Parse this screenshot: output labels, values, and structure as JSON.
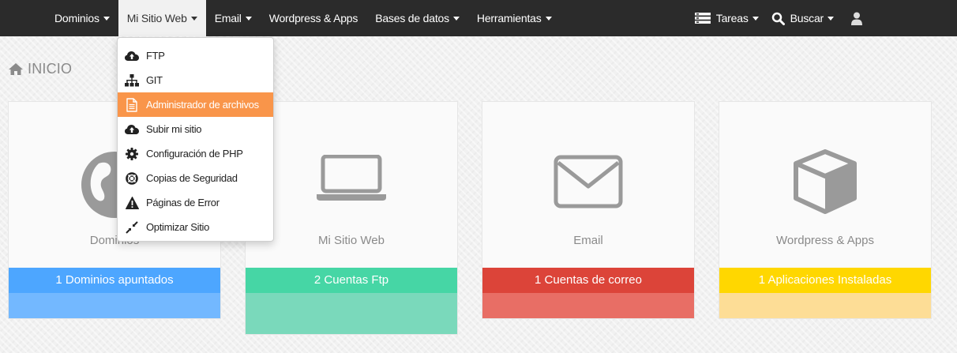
{
  "colors": {
    "navbar_bg": "#2b2b2b",
    "highlight": "#f9954a",
    "card_domains_stat": "#4da6ff",
    "card_domains_footer": "#73b8ff",
    "card_site_stat": "#46d6a5",
    "card_site_footer": "#7ad9bb",
    "card_email_stat": "#dc4439",
    "card_email_footer": "#e86e65",
    "card_apps_stat": "#ffd700",
    "card_apps_footer": "#fddd96"
  },
  "navbar": {
    "items": [
      {
        "label": "Dominios"
      },
      {
        "label": "Mi Sitio Web"
      },
      {
        "label": "Email"
      },
      {
        "label": "Wordpress & Apps"
      },
      {
        "label": "Bases de datos"
      },
      {
        "label": "Herramientas"
      }
    ],
    "tasks_label": "Tareas",
    "search_label": "Buscar"
  },
  "page": {
    "title": "INICIO"
  },
  "dropdown": {
    "items": [
      {
        "label": "FTP",
        "icon": "cloud-upload-icon"
      },
      {
        "label": "GIT",
        "icon": "sitemap-icon"
      },
      {
        "label": "Administrador de archivos",
        "icon": "file-icon"
      },
      {
        "label": "Subir mi sitio",
        "icon": "cloud-upload-icon"
      },
      {
        "label": "Configuración de PHP",
        "icon": "gear-icon"
      },
      {
        "label": "Copias de Seguridad",
        "icon": "life-ring-icon"
      },
      {
        "label": "Páginas de Error",
        "icon": "warning-icon"
      },
      {
        "label": "Optimizar Sitio",
        "icon": "compress-icon"
      }
    ]
  },
  "cards": [
    {
      "label": "Dominios",
      "stat": "1 Dominios apuntados",
      "icon": "globe-icon"
    },
    {
      "label": "Mi Sitio Web",
      "stat": "2 Cuentas Ftp",
      "icon": "laptop-icon"
    },
    {
      "label": "Email",
      "stat": "1 Cuentas de correo",
      "icon": "envelope-icon"
    },
    {
      "label": "Wordpress & Apps",
      "stat": "1 Aplicaciones Instaladas",
      "icon": "cube-icon"
    }
  ]
}
